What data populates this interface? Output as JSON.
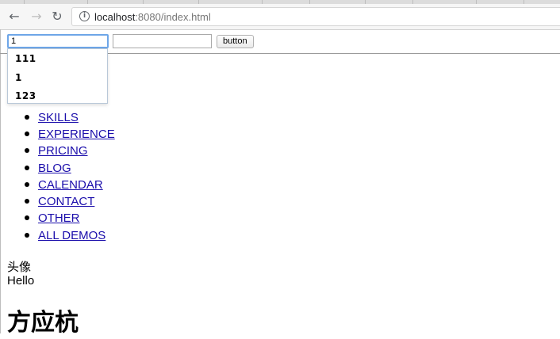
{
  "browser": {
    "back_icon": "arrow-left-icon",
    "forward_icon": "arrow-right-icon",
    "reload_icon": "reload-icon",
    "info_icon": "info-icon",
    "url_host": "localhost",
    "url_rest": ":8080/index.html"
  },
  "form": {
    "input1_value": "1",
    "input2_value": "",
    "button_label": "button"
  },
  "autocomplete": {
    "items": [
      "111",
      "1",
      "123"
    ]
  },
  "nav": {
    "items": [
      "SKILLS",
      "EXPERIENCE",
      "PRICING",
      "BLOG",
      "CALENDAR",
      "CONTACT",
      "OTHER",
      "ALL DEMOS"
    ]
  },
  "content": {
    "avatar_label": "头像",
    "hello": "Hello",
    "heading": "方应杭"
  }
}
